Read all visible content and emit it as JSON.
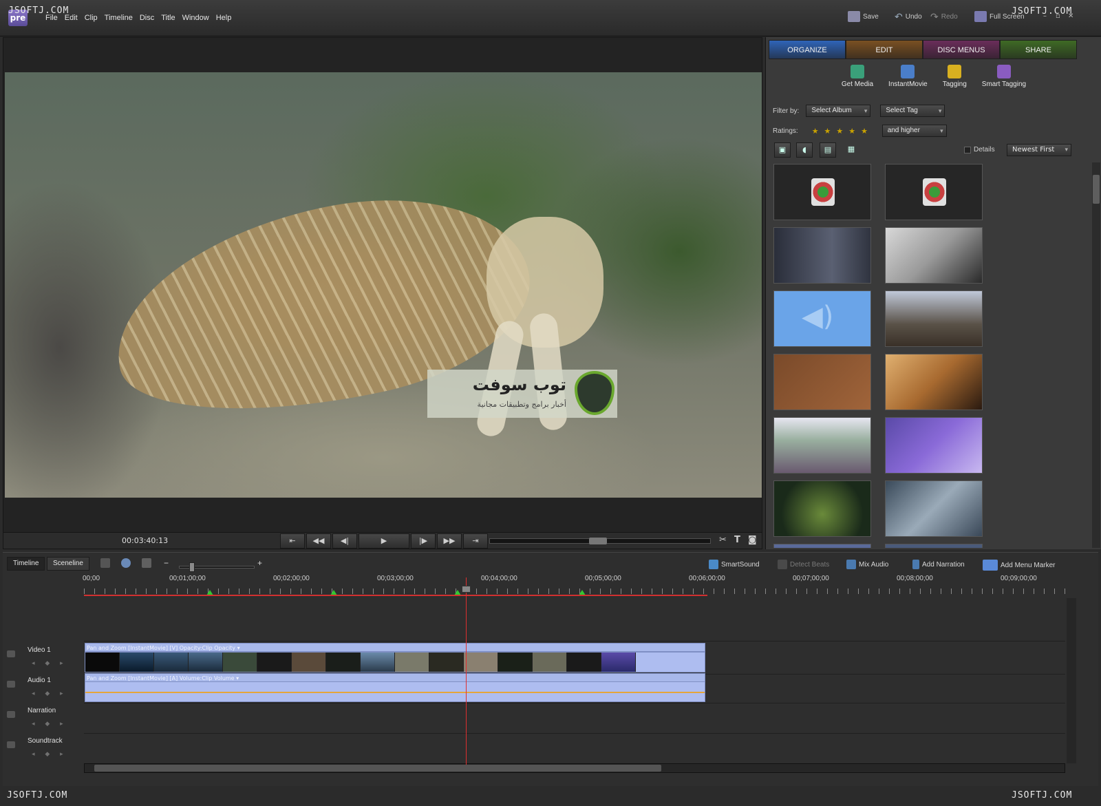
{
  "watermarks": {
    "top_left": "JSOFTJ.COM",
    "top_right": "JSOFTJ.COM",
    "bottom_left": "JSOFTJ.COM",
    "bottom_right": "JSOFTJ.COM"
  },
  "app": {
    "logo_text": "pre"
  },
  "menu": [
    "File",
    "Edit",
    "Clip",
    "Timeline",
    "Disc",
    "Title",
    "Window",
    "Help"
  ],
  "toolbar": {
    "save": "Save",
    "undo": "Undo",
    "redo": "Redo",
    "fullscreen": "Full Screen"
  },
  "overlay": {
    "title": "توب سوفت",
    "subtitle": "أخبار برامج وتطبيقات مجانية"
  },
  "monitor": {
    "timecode": "00:03:40:13"
  },
  "tasks": {
    "tabs": [
      {
        "label": "ORGANIZE",
        "color": "#2f64b8"
      },
      {
        "label": "EDIT",
        "color": "#7a5022"
      },
      {
        "label": "DISC MENUS",
        "color": "#6a2d5a"
      },
      {
        "label": "SHARE",
        "color": "#3f6a25"
      }
    ]
  },
  "organize_tools": [
    {
      "label": "Get Media",
      "icon": "get-media-icon",
      "color": "#3aa07a"
    },
    {
      "label": "InstantMovie",
      "icon": "instantmovie-icon",
      "color": "#4a7ec9"
    },
    {
      "label": "Tagging",
      "icon": "tag-icon",
      "color": "#d8b020"
    },
    {
      "label": "Smart Tagging",
      "icon": "smart-tag-icon",
      "color": "#8a5cc0"
    }
  ],
  "filters": {
    "filter_label": "Filter by:",
    "album": "Select Album",
    "tag": "Select Tag",
    "ratings_label": "Ratings:",
    "stars": "★★★★★",
    "rating_mode": "and higher",
    "details_label": "Details",
    "sort": "Newest First"
  },
  "timeline": {
    "tab_timeline": "Timeline",
    "tab_sceneline": "Sceneline",
    "zoom_minus": "−",
    "zoom_plus": "+",
    "buttons": {
      "smartsound": "SmartSound",
      "detect_beats": "Detect Beats",
      "mix_audio": "Mix Audio",
      "add_narration": "Add Narration",
      "add_menu_marker": "Add Menu Marker"
    },
    "ruler": [
      "00;00",
      "00;01;00;00",
      "00;02;00;00",
      "00;03;00;00",
      "00;04;00;00",
      "00;05;00;00",
      "00;06;00;00",
      "00;07;00;00",
      "00;08;00;00",
      "00;09;00;00"
    ],
    "tracks": [
      "Video 1",
      "Audio 1",
      "Narration",
      "Soundtrack"
    ],
    "video_clip_label": "Pan and Zoom [InstantMovie] [V]  Opacity:Clip Opacity ▾",
    "audio_clip_label": "Pan and Zoom [InstantMovie] [A]  Volume:Clip Volume ▾",
    "track_arrows": "◂ ◆ ▸"
  }
}
